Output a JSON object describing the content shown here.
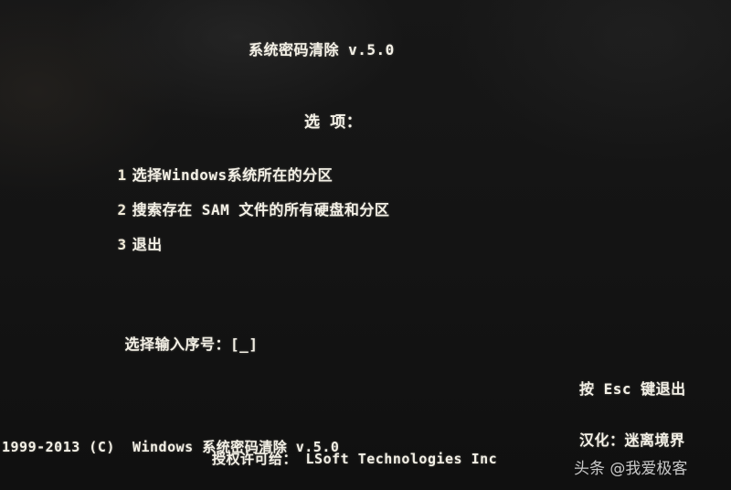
{
  "title": "系统密码清除 v.5.0",
  "options_heading": "选 项：",
  "menu": {
    "items": [
      {
        "number": "1",
        "label": "选择Windows系统所在的分区"
      },
      {
        "number": "2",
        "label": "搜索存在 SAM 文件的所有硬盘和分区"
      },
      {
        "number": "3",
        "label": "退出"
      }
    ]
  },
  "prompt": {
    "label": "选择输入序号：",
    "input_value": "[_]"
  },
  "esc_hint": "按 Esc 键退出",
  "footer": {
    "copyright": "1999-2013 (C)  Windows 系统密码清除 v.5.0",
    "license": "授权许可给： LSoft Technologies Inc",
    "translator": "汉化：迷离境界"
  },
  "watermark": "头条 @我爱极客"
}
